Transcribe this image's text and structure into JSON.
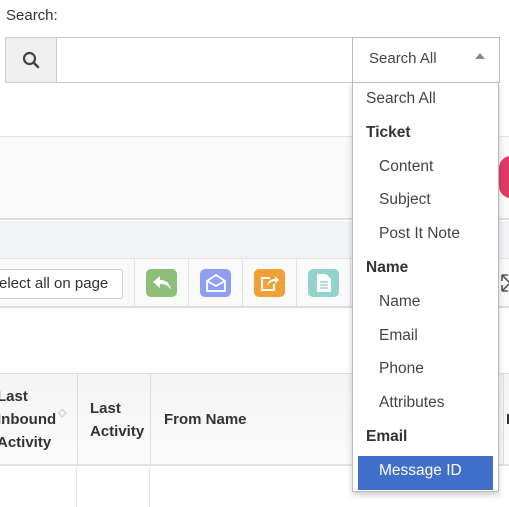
{
  "search": {
    "label": "Search:",
    "value": "",
    "selected": "Search All",
    "icon": "search-icon"
  },
  "dropdown": {
    "options": [
      {
        "label": "Search All",
        "type": "option"
      },
      {
        "label": "Ticket",
        "type": "group"
      },
      {
        "label": "Content",
        "type": "sub"
      },
      {
        "label": "Subject",
        "type": "sub"
      },
      {
        "label": "Post It Note",
        "type": "sub"
      },
      {
        "label": "Name",
        "type": "group"
      },
      {
        "label": "Name",
        "type": "sub"
      },
      {
        "label": "Email",
        "type": "sub"
      },
      {
        "label": "Phone",
        "type": "sub"
      },
      {
        "label": "Attributes",
        "type": "sub"
      },
      {
        "label": "Email",
        "type": "group"
      },
      {
        "label": "Message ID",
        "type": "sub",
        "highlighted": true
      }
    ]
  },
  "toolbar": {
    "select_all": "elect all on page",
    "buttons": [
      {
        "icon": "reply-icon",
        "color": "#8dbf78"
      },
      {
        "icon": "envelope-open-icon",
        "color": "#8f9ff0"
      },
      {
        "icon": "forward-icon",
        "color": "#f0a035"
      },
      {
        "icon": "note-icon",
        "color": "#93d3ce"
      }
    ],
    "expand_icon": "expand-icon"
  },
  "table": {
    "columns": [
      "Last\nInbound\nActivity",
      "Last\nActivity",
      "From Name",
      "F"
    ]
  },
  "colors": {
    "accent": "#3f6fcb",
    "pink": "#e03a66"
  }
}
